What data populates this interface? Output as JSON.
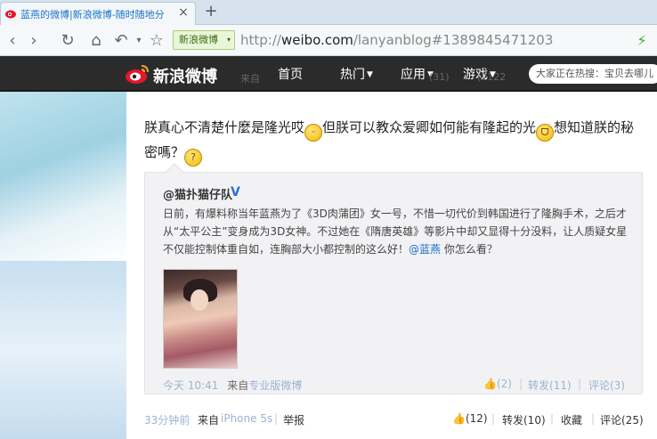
{
  "browser": {
    "tab_title": "蓝燕的微博|新浪微博-随时随地分",
    "new_tab_symbol": "+",
    "site_chip": "新浪微博",
    "url_scheme": "http://",
    "url_host": "weibo.com",
    "url_path": "/lanyanblog#1389845471203"
  },
  "nav": {
    "logo_text": "新浪微博",
    "items": [
      "首页",
      "热门",
      "应用",
      "游戏"
    ],
    "search_placeholder": "大家正在热搜：宝贝去哪儿",
    "ghost_from": "来自",
    "ghost_count1": "(31)",
    "ghost_count2": "(2122"
  },
  "post": {
    "text_part1": "朕真心不清楚什麼是隆光哎",
    "text_part2": "但朕可以教众爱卿如何能有隆起的光",
    "text_part3": "想知道朕的秘密嗎？",
    "footer_time": "33分钟前",
    "footer_from": "来自",
    "footer_device": "iPhone 5s",
    "footer_report": "举报",
    "like_count": "(12)",
    "repost_label": "转发(10)",
    "fav_label": "收藏",
    "comment_label": "评论(25)"
  },
  "repost": {
    "user": "@猫扑猫仔队",
    "text": "日前，有爆料称当年蓝燕为了《3D肉蒲团》女一号，不惜一切代价到韩国进行了隆胸手术，之后才从“太平公主”变身成为3D女神。不过她在《隋唐英雄》等影片中却又显得十分没料，让人质疑女星不仅能控制体重自如，连胸部大小都控制的这么好！",
    "mention": "@蓝燕",
    "text_tail": " 你怎么看？",
    "time": "今天 10:41",
    "from": "来自",
    "source": "专业版微博",
    "like_count": "(2)",
    "repost_label": "转发(11)",
    "comment_label": "评论(3)"
  },
  "colors": {
    "nav_bg": "#2b2b2b",
    "link_blue": "#2a6fd6",
    "muted": "#9bb4cf"
  }
}
